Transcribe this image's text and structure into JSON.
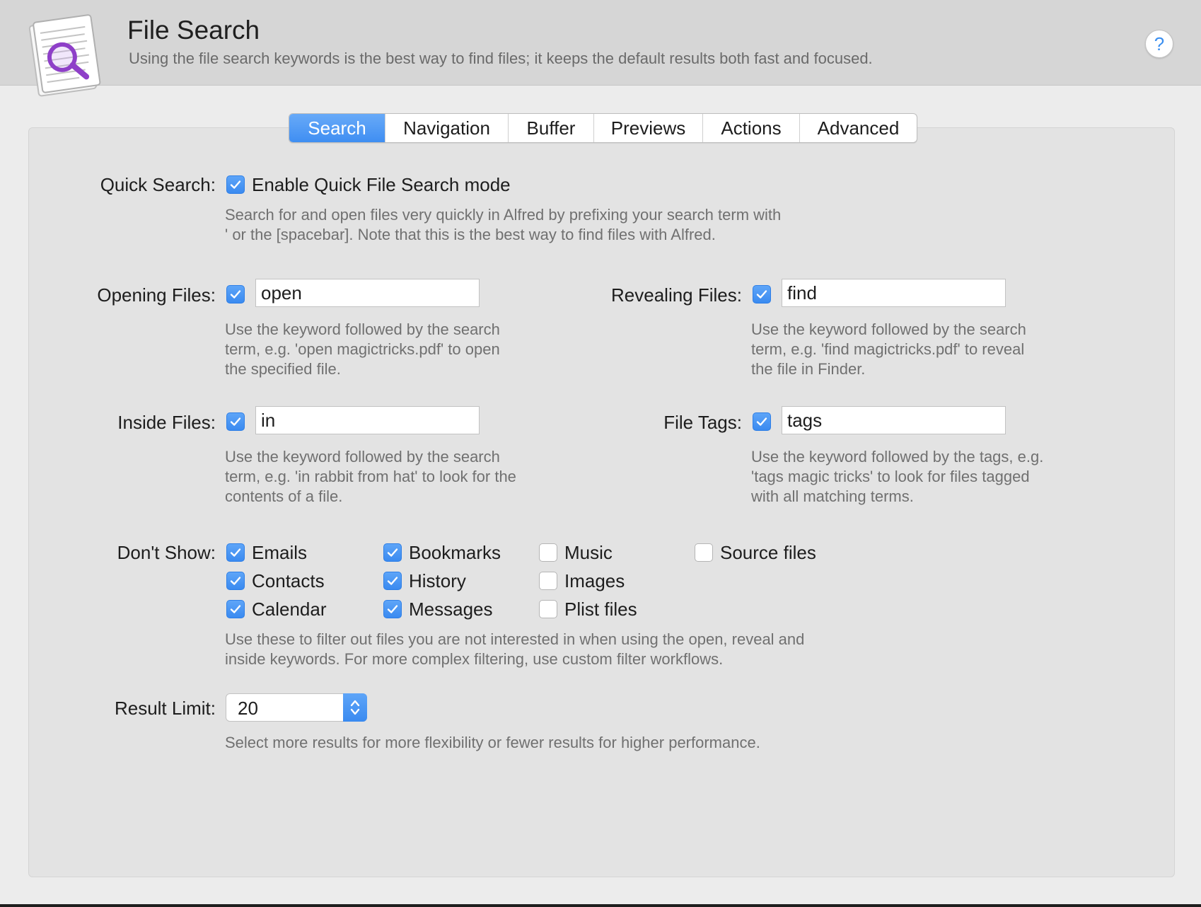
{
  "header": {
    "title": "File Search",
    "subtitle": "Using the file search keywords is the best way to find files; it keeps the default results both fast and focused.",
    "help_label": "?",
    "icon": "document-magnifier-icon"
  },
  "tabs": [
    {
      "label": "Search",
      "active": true
    },
    {
      "label": "Navigation",
      "active": false
    },
    {
      "label": "Buffer",
      "active": false
    },
    {
      "label": "Previews",
      "active": false
    },
    {
      "label": "Actions",
      "active": false
    },
    {
      "label": "Advanced",
      "active": false
    }
  ],
  "quick_search": {
    "label": "Quick Search:",
    "checkbox_label": "Enable Quick File Search mode",
    "checked": true,
    "description": "Search for and open files very quickly in Alfred by prefixing your search term with\n' or the [spacebar]. Note that this is the best way to find files with Alfred."
  },
  "opening_files": {
    "label": "Opening Files:",
    "checked": true,
    "value": "open",
    "description": "Use the keyword followed by the search\nterm, e.g. 'open magictricks.pdf' to open\nthe specified file."
  },
  "revealing_files": {
    "label": "Revealing Files:",
    "checked": true,
    "value": "find",
    "description": "Use the keyword followed by the search\nterm, e.g. 'find magictricks.pdf' to reveal\nthe file in Finder."
  },
  "inside_files": {
    "label": "Inside Files:",
    "checked": true,
    "value": "in",
    "description": "Use the keyword followed by the search\nterm, e.g. 'in rabbit from hat' to look for the\ncontents of a file."
  },
  "file_tags": {
    "label": "File Tags:",
    "checked": true,
    "value": "tags",
    "description": "Use the keyword followed by the tags, e.g.\n'tags magic tricks' to look for files tagged\nwith all matching terms."
  },
  "dont_show": {
    "label": "Don't Show:",
    "items": [
      {
        "label": "Emails",
        "checked": true
      },
      {
        "label": "Contacts",
        "checked": true
      },
      {
        "label": "Calendar",
        "checked": true
      },
      {
        "label": "Bookmarks",
        "checked": true
      },
      {
        "label": "History",
        "checked": true
      },
      {
        "label": "Messages",
        "checked": true
      },
      {
        "label": "Music",
        "checked": false
      },
      {
        "label": "Images",
        "checked": false
      },
      {
        "label": "Plist files",
        "checked": false
      },
      {
        "label": "Source files",
        "checked": false
      }
    ],
    "description": "Use these to filter out files you are not interested in when using the open, reveal and\ninside keywords. For more complex filtering, use custom filter workflows."
  },
  "result_limit": {
    "label": "Result Limit:",
    "value": "20",
    "description": "Select more results for more flexibility or fewer results for higher performance."
  },
  "colors": {
    "accent": "#3f8ef2",
    "header_bg": "#d6d6d6",
    "panel_bg": "#e3e3e3",
    "icon_purple": "#8e3fc8"
  }
}
